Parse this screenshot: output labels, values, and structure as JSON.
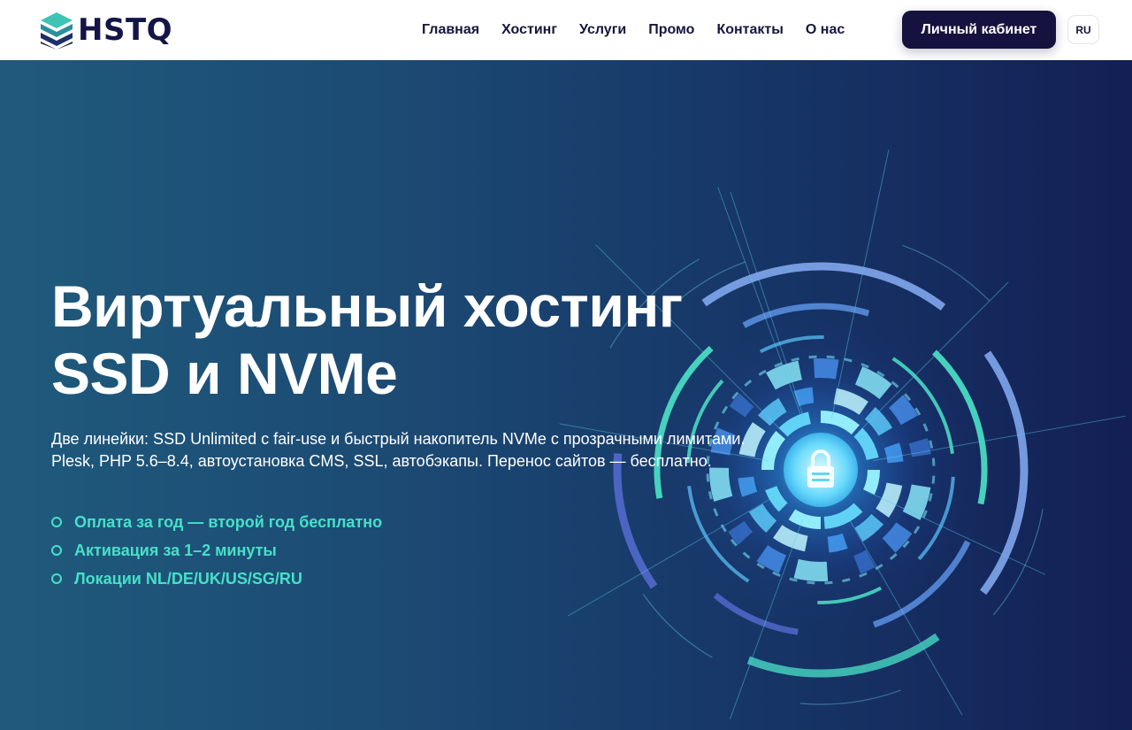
{
  "brand": {
    "name": "HSTQ"
  },
  "nav": {
    "items": [
      "Главная",
      "Хостинг",
      "Услуги",
      "Промо",
      "Контакты",
      "О нас"
    ]
  },
  "header": {
    "cabinet_label": "Личный кабинет",
    "language": "RU"
  },
  "hero": {
    "title_line1": "Виртуальный хостинг",
    "title_line2": "SSD и NVMe",
    "desc_line1": "Две линейки: SSD Unlimited с fair-use и быстрый накопитель NVMe с прозрачными лимитами.",
    "desc_line2": "Plesk, PHP 5.6–8.4, автоустановка CMS, SSL, автобэкапы. Перенос сайтов — бесплатно.",
    "features": [
      "Оплата за год — второй год бесплатно",
      "Активация за 1–2 минуты",
      "Локации NL/DE/UK/US/SG/RU"
    ],
    "art_icon": "lock-icon"
  },
  "colors": {
    "brand_dark": "#15123f",
    "accent_mint": "#46e0c8",
    "hero_left": "#1f5a7c",
    "hero_right": "#131f55"
  }
}
